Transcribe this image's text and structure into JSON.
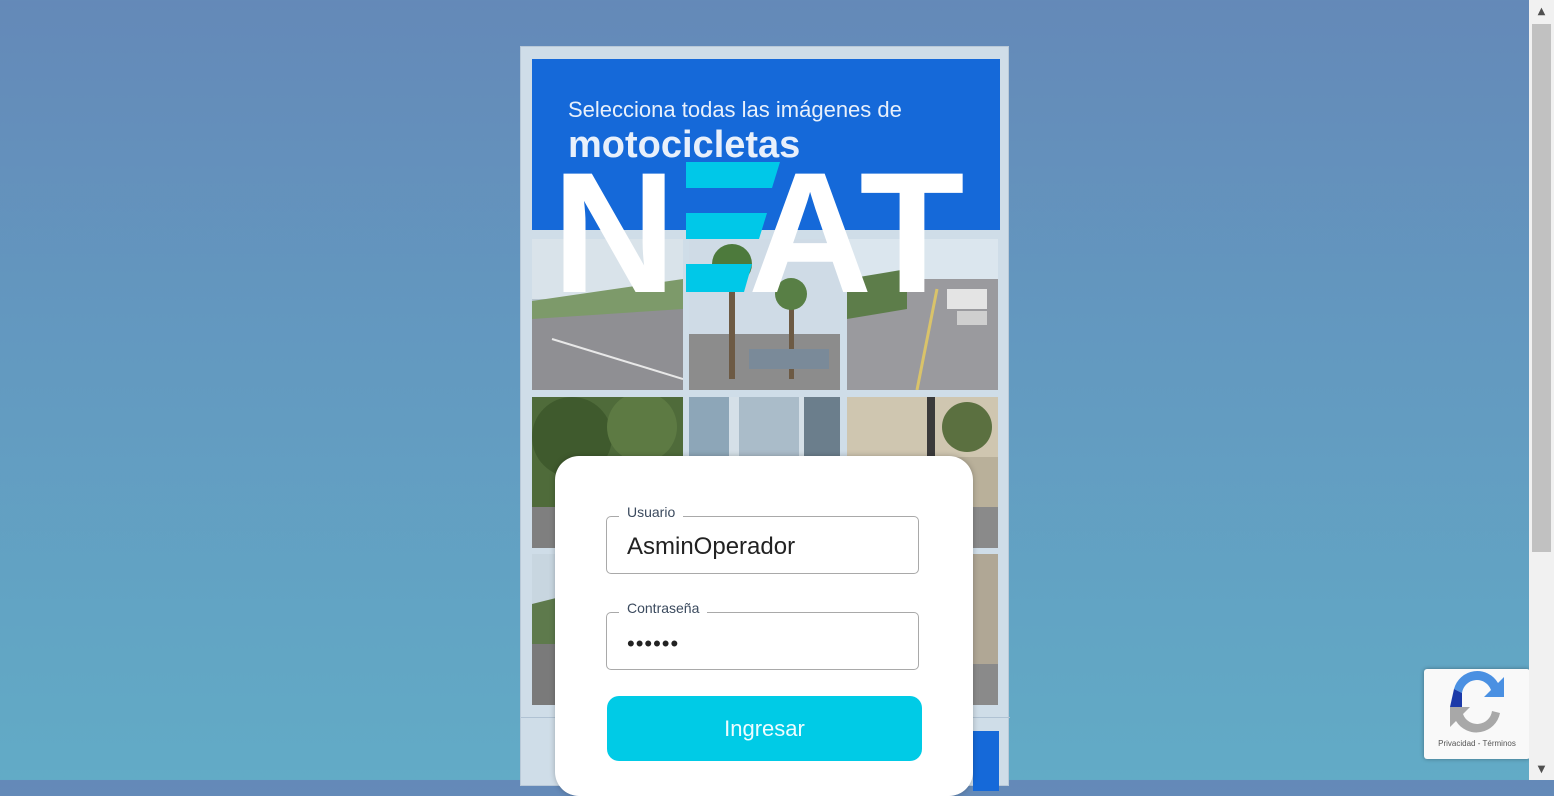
{
  "captcha": {
    "instruction": "Selecciona todas las imágenes de",
    "target": "motocicletas"
  },
  "logo": {
    "text_left": "N",
    "text_right": "AT",
    "accent_color": "#00c8e8"
  },
  "login": {
    "username_label": "Usuario",
    "username_value": "AsminOperador",
    "password_label": "Contraseña",
    "password_value": "••••••",
    "submit_label": "Ingresar"
  },
  "recaptcha": {
    "privacy": "Privacidad",
    "separator": "-",
    "terms": "Términos",
    "icon": "recaptcha-icon"
  },
  "colors": {
    "header_blue": "#1569d9",
    "button_cyan": "#00cbe6"
  }
}
